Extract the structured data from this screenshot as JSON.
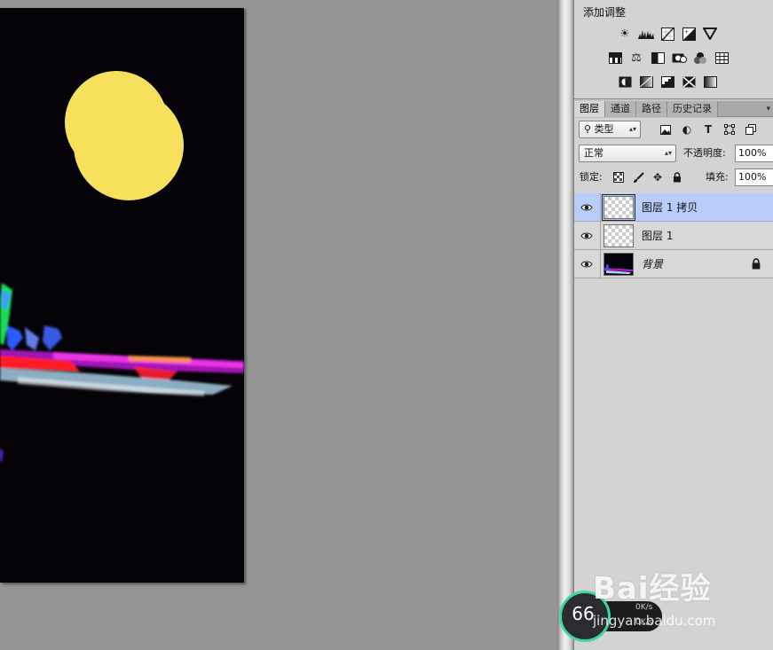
{
  "adjustments": {
    "title": "添加调整",
    "icons_row1": [
      "brightness-contrast-icon",
      "levels-icon",
      "curves-icon",
      "exposure-icon",
      "vibrance-icon"
    ],
    "icons_row2": [
      "hue-saturation-icon",
      "color-balance-icon",
      "black-white-icon",
      "photo-filter-icon",
      "channel-mixer-icon",
      "color-lookup-icon"
    ],
    "icons_row3": [
      "invert-icon",
      "posterize-icon",
      "threshold-icon",
      "selective-color-icon",
      "gradient-map-icon"
    ]
  },
  "tabs": [
    {
      "label": "图层",
      "active": true
    },
    {
      "label": "通道",
      "active": false
    },
    {
      "label": "路径",
      "active": false
    },
    {
      "label": "历史记录",
      "active": false
    }
  ],
  "filter": {
    "kind_label": "类型"
  },
  "blend": {
    "mode": "正常",
    "opacity_label": "不透明度:",
    "opacity_value": "100%"
  },
  "lock": {
    "label": "锁定:",
    "fill_label": "填充:",
    "fill_value": "100%"
  },
  "layers": [
    {
      "name": "图层 1 拷贝",
      "selected": true,
      "thumb": "transparent",
      "locked": false,
      "italic": false
    },
    {
      "name": "图层 1",
      "selected": false,
      "thumb": "transparent",
      "locked": false,
      "italic": false
    },
    {
      "name": "背景",
      "selected": false,
      "thumb": "image",
      "locked": true,
      "italic": true
    }
  ],
  "watermark": {
    "logo": "Bai经验",
    "url": "jingyan.baidu.com"
  },
  "speed_widget": {
    "percent": "66",
    "up": "0K/s",
    "down": "0K/s"
  },
  "colors": {
    "moon": "#f7e05b",
    "canvas_bg": "#050308",
    "workspace": "#959595",
    "selected_layer": "#b9cdfa"
  }
}
